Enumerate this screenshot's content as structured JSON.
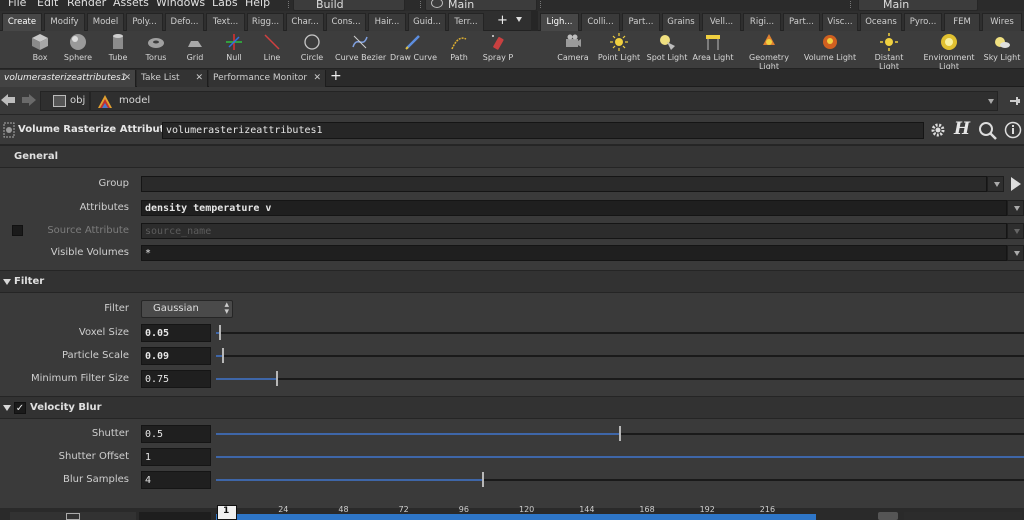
{
  "menubar": {
    "items": [
      "File",
      "Edit",
      "Render",
      "Assets",
      "Windows",
      "Labs",
      "Help"
    ],
    "desktop_left": "Build",
    "desktop_mid": "Main",
    "desktop_right": "Main"
  },
  "shelf_tabs_left": [
    "Create",
    "Modify",
    "Model",
    "Poly...",
    "Defo...",
    "Text...",
    "Rigg...",
    "Char...",
    "Cons...",
    "Hair...",
    "Guid...",
    "Terr..."
  ],
  "shelf_tabs_right": [
    "Ligh...",
    "Colli...",
    "Part...",
    "Grains",
    "Vell...",
    "Rigi...",
    "Part...",
    "Visc...",
    "Oceans",
    "Pyro...",
    "FEM",
    "Wires"
  ],
  "shelf_tools_left": [
    {
      "label": "Box",
      "icon": "box-icon"
    },
    {
      "label": "Sphere",
      "icon": "sphere-icon"
    },
    {
      "label": "Tube",
      "icon": "tube-icon"
    },
    {
      "label": "Torus",
      "icon": "torus-icon"
    },
    {
      "label": "Grid",
      "icon": "grid-icon"
    },
    {
      "label": "Null",
      "icon": "null-icon"
    },
    {
      "label": "Line",
      "icon": "line-icon"
    },
    {
      "label": "Circle",
      "icon": "circle-icon"
    },
    {
      "label": "Curve Bezier",
      "icon": "curve-bezier-icon"
    },
    {
      "label": "Draw Curve",
      "icon": "draw-curve-icon"
    },
    {
      "label": "Path",
      "icon": "path-icon"
    },
    {
      "label": "Spray P",
      "icon": "spray-paint-icon"
    }
  ],
  "shelf_tools_right": [
    {
      "label": "Camera",
      "icon": "camera-icon"
    },
    {
      "label": "Point Light",
      "icon": "point-light-icon"
    },
    {
      "label": "Spot Light",
      "icon": "spot-light-icon"
    },
    {
      "label": "Area Light",
      "icon": "area-light-icon"
    },
    {
      "label": "Geometry\nLight",
      "icon": "geometry-light-icon"
    },
    {
      "label": "Volume Light",
      "icon": "volume-light-icon"
    },
    {
      "label": "Distant\nLight",
      "icon": "distant-light-icon"
    },
    {
      "label": "Environment\nLight",
      "icon": "environment-light-icon"
    },
    {
      "label": "Sky Light",
      "icon": "sky-light-icon"
    }
  ],
  "pane_tabs": [
    "volumerasterizeattributes1",
    "Take List",
    "Performance Monitor"
  ],
  "path": {
    "obj": "obj",
    "model": "model"
  },
  "node": {
    "type_label": "Volume Rasterize Attributes",
    "name": "volumerasterizeattributes1"
  },
  "general": {
    "title": "General",
    "group_label": "Group",
    "group_value": "",
    "attributes_label": "Attributes",
    "attributes_value": "density temperature v",
    "source_label": "Source Attribute",
    "source_placeholder": "source_name",
    "visible_label": "Visible Volumes",
    "visible_value": "*"
  },
  "filter": {
    "title": "Filter",
    "filter_label": "Filter",
    "filter_value": "Gaussian",
    "voxel_label": "Voxel Size",
    "voxel_value": "0.05",
    "voxel_slider": 0.005,
    "particle_label": "Particle Scale",
    "particle_value": "0.09",
    "particle_slider": 0.009,
    "minfilter_label": "Minimum Filter Size",
    "minfilter_value": "0.75",
    "minfilter_slider": 0.075
  },
  "velocity_blur": {
    "title": "Velocity Blur",
    "enabled": true,
    "shutter_label": "Shutter",
    "shutter_value": "0.5",
    "shutter_slider": 0.5,
    "offset_label": "Shutter Offset",
    "offset_value": "1",
    "offset_slider": 1.0,
    "samples_label": "Blur Samples",
    "samples_value": "4",
    "samples_slider": 0.33
  },
  "timeline": {
    "current_frame": "1",
    "ticks": [
      "24",
      "48",
      "72",
      "96",
      "120",
      "144",
      "168",
      "192",
      "216"
    ]
  },
  "colors": {
    "accent": "#3e66a8"
  }
}
